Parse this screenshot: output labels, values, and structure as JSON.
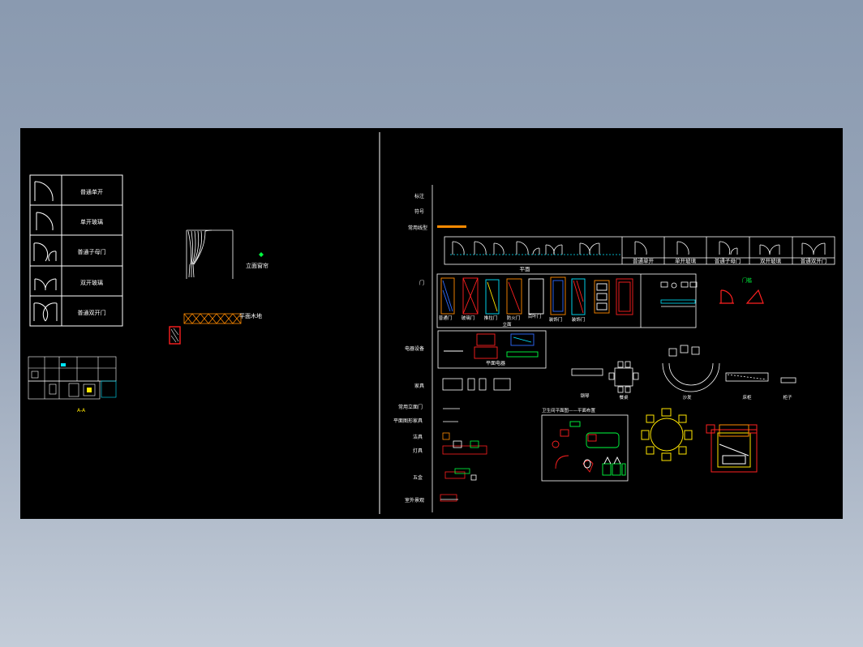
{
  "colors": {
    "background": "#000000",
    "line": "#ffffff",
    "red": "#ff2020",
    "yellow": "#ffe600",
    "green": "#00ff40",
    "cyan": "#00e5ff",
    "orange": "#ff8a00",
    "blue": "#2f6bff"
  },
  "legend_table": {
    "rows": [
      {
        "label": "普通单开",
        "icon": "single-door-icon"
      },
      {
        "label": "单开玻璃",
        "icon": "glass-door-icon"
      },
      {
        "label": "普通子母门",
        "icon": "mother-child-door-icon"
      },
      {
        "label": "双开玻璃",
        "icon": "double-glass-door-icon"
      },
      {
        "label": "普通双开门",
        "icon": "double-door-icon"
      }
    ]
  },
  "curtain": {
    "label": "立面窗帘"
  },
  "floor": {
    "label": "平面木地"
  },
  "side_labels": [
    "标注",
    "符号",
    "常用线型",
    "门",
    "电器设备",
    "家具",
    "常用立面门",
    "平面图形家具",
    "洁具",
    "灯具",
    "五金",
    "室外景观"
  ],
  "door_types": {
    "caption": "平面",
    "labels": [
      "普通单开",
      "单开玻璃",
      "普通子母门",
      "双开玻璃",
      "普通双开门"
    ]
  },
  "elev_doors": {
    "caption": "立面",
    "labels": [
      "普通门",
      "玻璃门",
      "推拉门",
      "防火门",
      "百叶门",
      "装饰门",
      "装饰门"
    ]
  },
  "small_labels": {
    "red_glyph": "门槛",
    "equipment_caption": "平面电器",
    "bath_title": "卫生间平面图——平面布置",
    "furniture_1": "钢琴",
    "furniture_2": "餐桌",
    "furniture_3": "沙发",
    "furniture_4": "床柜",
    "furniture_5": "柜子",
    "left_caption": "A-A"
  }
}
